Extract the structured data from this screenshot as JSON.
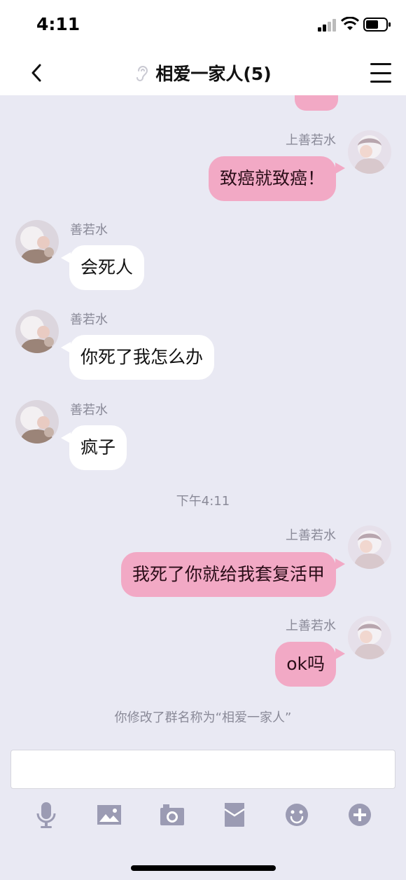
{
  "status_bar": {
    "time": "4:11"
  },
  "header": {
    "title": "相爱一家人(5)"
  },
  "messages": [
    {
      "sender": "上善若水",
      "text": "致癌就致癌！",
      "side": "me"
    },
    {
      "sender": "善若水",
      "text": "会死人",
      "side": "other"
    },
    {
      "sender": "善若水",
      "text": "你死了我怎么办",
      "side": "other"
    },
    {
      "sender": "善若水",
      "text": "疯子",
      "side": "other"
    },
    {
      "sender": "上善若水",
      "text": "我死了你就给我套复活甲",
      "side": "me"
    },
    {
      "sender": "上善若水",
      "text": "ok吗",
      "side": "me"
    }
  ],
  "timestamp": "下午4:11",
  "system_message": "你修改了群名称为“相爱一家人”",
  "input": {
    "value": "",
    "placeholder": ""
  },
  "toolbar": {
    "icons": [
      "microphone-icon",
      "image-icon",
      "camera-icon",
      "red-packet-icon",
      "emoji-icon",
      "plus-icon"
    ]
  },
  "colors": {
    "background": "#e9e9f3",
    "my_bubble": "#f2a9c5",
    "other_bubble": "#ffffff",
    "icon_gray": "#9b9bb3",
    "secondary_text": "#8a8a98"
  }
}
